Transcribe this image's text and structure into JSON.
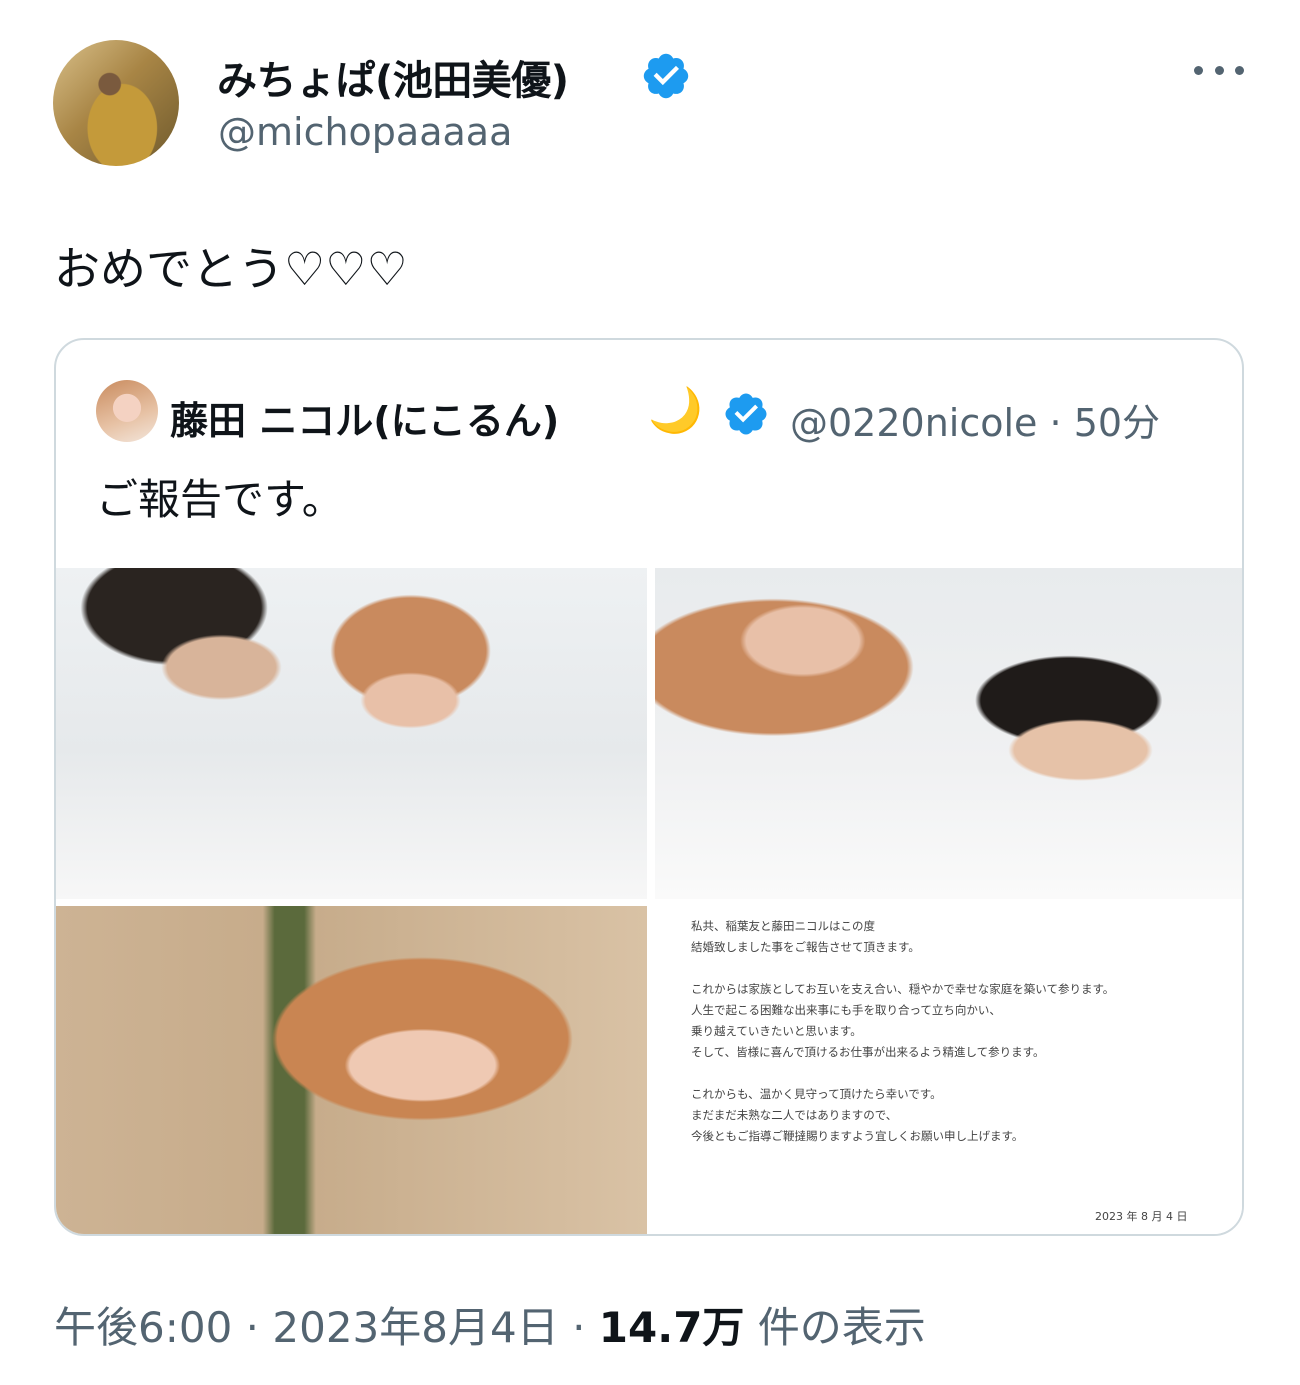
{
  "author": {
    "display_name": "みちょぱ(池田美優)",
    "handle": "@michopaaaaa"
  },
  "tweet": {
    "text": "おめでとう♡♡♡"
  },
  "quoted_tweet": {
    "display_name": "藤田 ニコル(にこるん)",
    "emoji": "🌙",
    "handle": "@0220nicole",
    "time": "· 50分",
    "text": "ご報告です。",
    "letter": {
      "lines": [
        "私共、稲葉友と藤田ニコルはこの度",
        "結婚致しました事をご報告させて頂きます。",
        "これからは家族としてお互いを支え合い、穏やかで幸せな家庭を築いて参ります。",
        "人生で起こる困難な出来事にも手を取り合って立ち向かい、",
        "乗り越えていきたいと思います。",
        "そして、皆様に喜んで頂けるお仕事が出来るよう精進して参ります。",
        "これからも、温かく見守って頂けたら幸いです。",
        "まだまだ未熟な二人ではありますので、",
        "今後ともご指導ご鞭撻賜りますよう宜しくお願い申し上げます。"
      ],
      "date": "2023 年 8 月 4 日"
    }
  },
  "meta": {
    "time": "午後6:00",
    "sep1": " · ",
    "date": "2023年8月4日",
    "sep2": " · ",
    "views": "14.7万",
    "views_suffix": " 件の表示"
  },
  "colors": {
    "verified": "#1d9bf0",
    "secondary_text": "#536471",
    "border": "#cfd9de"
  },
  "icons": {
    "verified": "verified-badge-icon",
    "more": "more-horizontal-icon"
  }
}
